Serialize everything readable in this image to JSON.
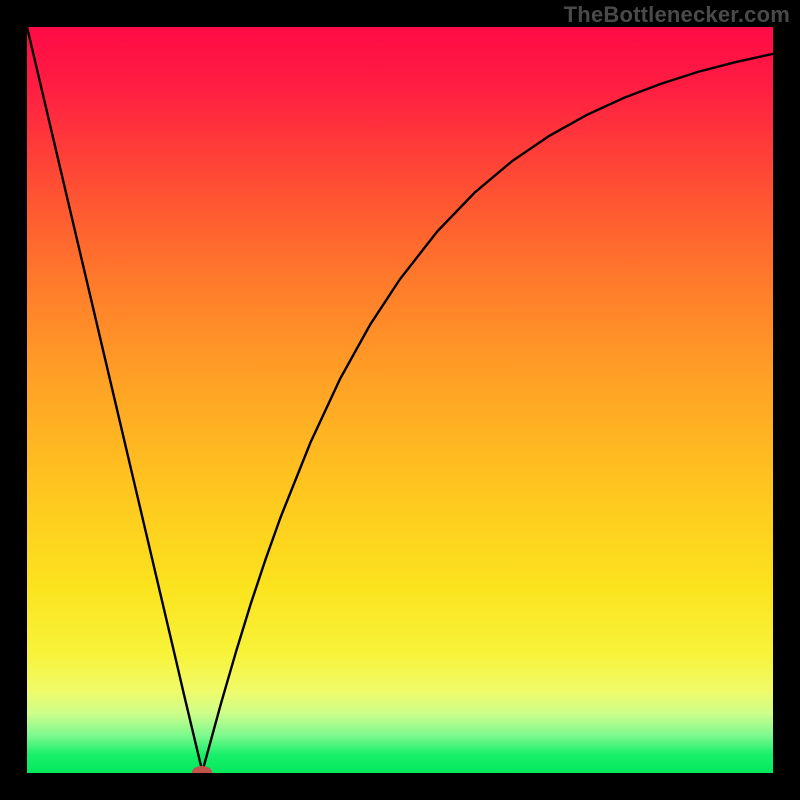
{
  "attribution": "TheBottlenecker.com",
  "chart_data": {
    "type": "line",
    "title": "",
    "xlabel": "",
    "ylabel": "",
    "xlim": [
      0,
      100
    ],
    "ylim": [
      0,
      100
    ],
    "x": [
      0,
      2,
      4,
      6,
      8,
      10,
      12,
      14,
      16,
      18,
      20,
      21,
      22,
      23,
      23.5,
      24,
      26,
      28,
      30,
      32,
      34,
      38,
      42,
      46,
      50,
      55,
      60,
      65,
      70,
      75,
      80,
      85,
      90,
      95,
      100
    ],
    "values": [
      100,
      91.5,
      83,
      74.5,
      66,
      57.5,
      49,
      40.5,
      32,
      23.5,
      15,
      10.7,
      6.5,
      2.3,
      0.2,
      2,
      9.3,
      16.2,
      22.7,
      28.7,
      34.3,
      44.3,
      52.9,
      60.1,
      66.2,
      72.6,
      77.8,
      82.0,
      85.4,
      88.2,
      90.5,
      92.4,
      94.0,
      95.3,
      96.4
    ],
    "marker": {
      "x": 23.5,
      "y": 0.2
    },
    "background_gradient": {
      "top_color": "#ff0a46",
      "bottom_color": "#04e85c"
    }
  }
}
